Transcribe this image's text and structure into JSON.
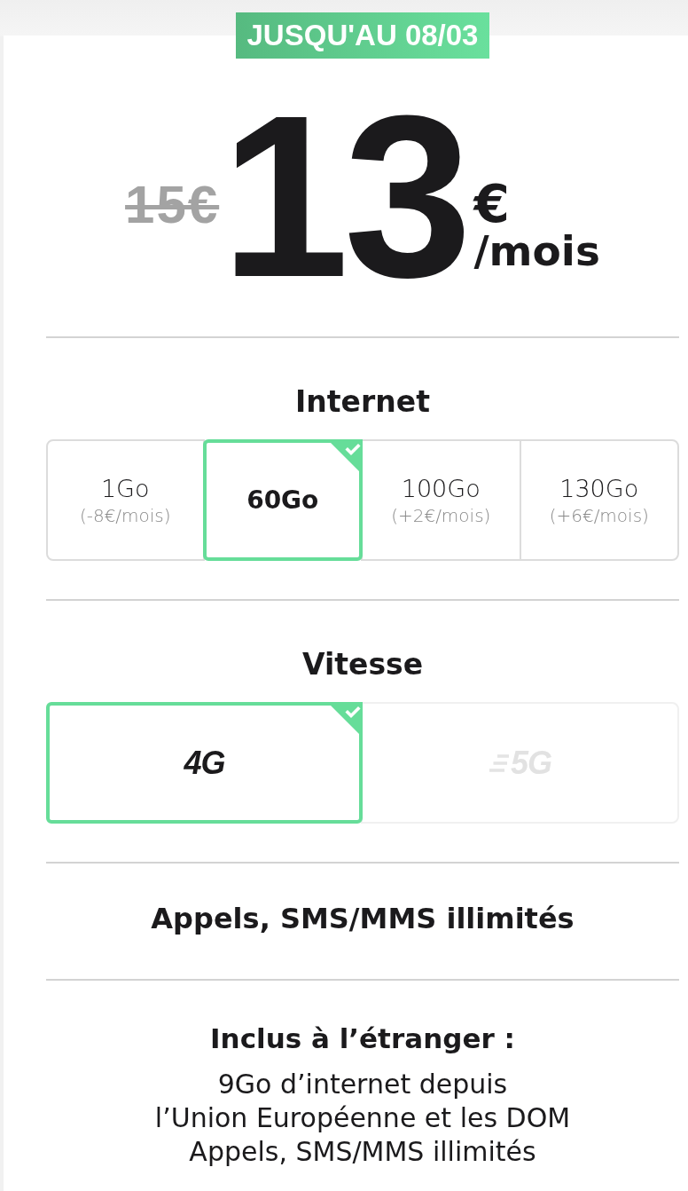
{
  "promo_badge": "JUSQU'AU 08/03",
  "price": {
    "old": "15€",
    "amount": "13",
    "currency": "€",
    "period": "/mois"
  },
  "internet": {
    "title": "Internet",
    "options": [
      {
        "label": "1Go",
        "price_delta": "(-8€/mois)",
        "selected": false
      },
      {
        "label": "60Go",
        "selected": true
      },
      {
        "label": "100Go",
        "price_delta": "(+2€/mois)",
        "selected": false
      },
      {
        "label": "130Go",
        "price_delta": "(+6€/mois)",
        "selected": false
      }
    ]
  },
  "speed": {
    "title": "Vitesse",
    "options": [
      {
        "label": "4G",
        "kind": "plain",
        "selected": true,
        "disabled": false
      },
      {
        "label": "5G",
        "kind": "lines",
        "selected": false,
        "disabled": true
      }
    ]
  },
  "features": [
    {
      "title": "Appels, SMS/MMS illimités"
    },
    {
      "title": "Inclus à l’étranger :",
      "lines": [
        "9Go d’internet depuis",
        "l’Union Européenne et les DOM",
        "Appels, SMS/MMS illimités"
      ]
    }
  ]
}
